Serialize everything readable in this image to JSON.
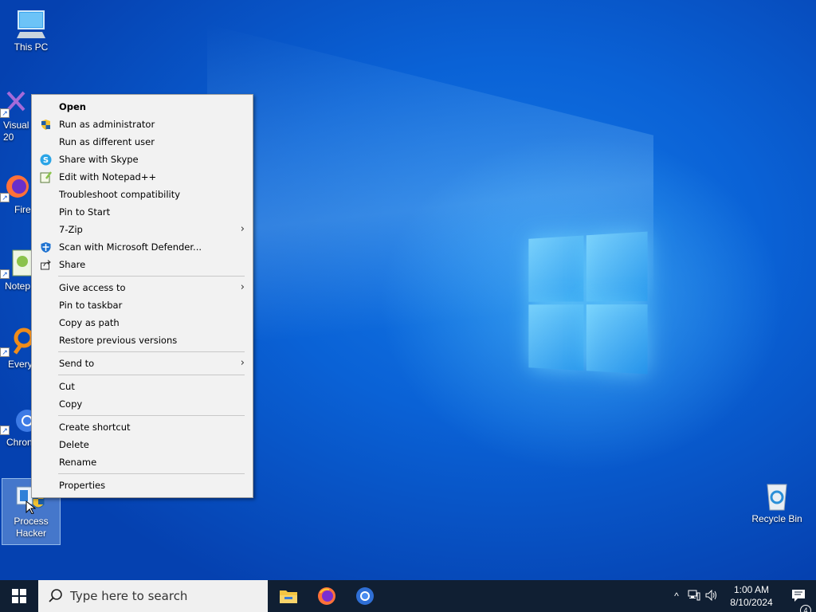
{
  "desktop_icons": [
    {
      "label": "This PC",
      "icon": "this-pc-icon"
    },
    {
      "label": "Visual\n20",
      "icon": "visual-studio-icon"
    },
    {
      "label": "Fire",
      "icon": "firefox-icon"
    },
    {
      "label": "Notep",
      "icon": "notepad-icon"
    },
    {
      "label": "Every",
      "icon": "everything-icon"
    },
    {
      "label": "Chron",
      "icon": "chrome-icon"
    },
    {
      "label": "Process Hacker",
      "icon": "process-hacker-icon"
    },
    {
      "label": "Recycle Bin",
      "icon": "recycle-bin-icon"
    }
  ],
  "context_menu": {
    "items": [
      {
        "label": "Open"
      },
      {
        "label": "Run as administrator",
        "icon": "shield-icon"
      },
      {
        "label": "Run as different user"
      },
      {
        "label": "Share with Skype",
        "icon": "skype-icon"
      },
      {
        "label": "Edit with Notepad++",
        "icon": "notepad-plus-icon"
      },
      {
        "label": "Troubleshoot compatibility"
      },
      {
        "label": "Pin to Start"
      },
      {
        "label": "7-Zip"
      },
      {
        "label": "Scan with Microsoft Defender...",
        "icon": "defender-icon"
      },
      {
        "label": "Share",
        "icon": "share-icon"
      },
      {
        "label": "Give access to"
      },
      {
        "label": "Pin to taskbar"
      },
      {
        "label": "Copy as path"
      },
      {
        "label": "Restore previous versions"
      },
      {
        "label": "Send to"
      },
      {
        "label": "Cut"
      },
      {
        "label": "Copy"
      },
      {
        "label": "Create shortcut"
      },
      {
        "label": "Delete"
      },
      {
        "label": "Rename"
      },
      {
        "label": "Properties"
      }
    ],
    "submenu_arrow": "›"
  },
  "taskbar": {
    "search_placeholder": "Type here to search",
    "pinned": [
      "file-explorer-icon",
      "firefox-icon",
      "chrome-icon"
    ],
    "clock_time": "1:00 AM",
    "clock_date": "8/10/2024",
    "notification_count": "4",
    "tray_chevron": "^"
  },
  "colors": {
    "taskbar": "#101f33",
    "menu_bg": "#f2f2f2",
    "wallpaper": "#0a62d6"
  }
}
